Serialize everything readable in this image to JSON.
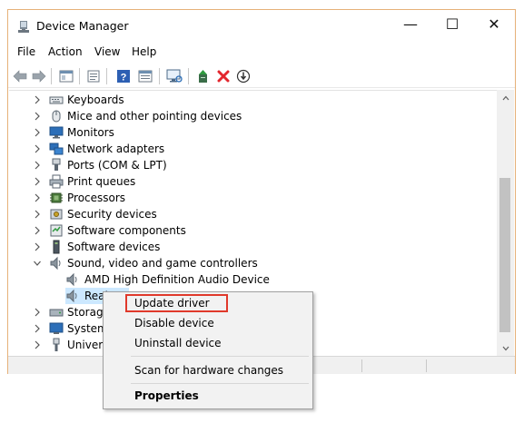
{
  "window": {
    "title": "Device Manager",
    "title_icon": "computer-manage-icon",
    "controls": {
      "minimize": "—",
      "maximize": "☐",
      "close": "✕"
    }
  },
  "menu": [
    "File",
    "Action",
    "View",
    "Help"
  ],
  "toolbar": [
    "back-icon",
    "forward-icon",
    "properties-pane-icon",
    "details-icon",
    "help-icon",
    "device-view-icon",
    "monitor-scan-icon",
    "update-driver-icon",
    "uninstall-icon",
    "disable-icon"
  ],
  "tree": [
    {
      "label": "Keyboards",
      "expanded": false,
      "icon": "keyboard-icon"
    },
    {
      "label": "Mice and other pointing devices",
      "expanded": false,
      "icon": "mouse-icon"
    },
    {
      "label": "Monitors",
      "expanded": false,
      "icon": "monitor-icon"
    },
    {
      "label": "Network adapters",
      "expanded": false,
      "icon": "network-icon"
    },
    {
      "label": "Ports (COM & LPT)",
      "expanded": false,
      "icon": "port-icon"
    },
    {
      "label": "Print queues",
      "expanded": false,
      "icon": "printer-icon"
    },
    {
      "label": "Processors",
      "expanded": false,
      "icon": "processor-icon"
    },
    {
      "label": "Security devices",
      "expanded": false,
      "icon": "security-icon"
    },
    {
      "label": "Software components",
      "expanded": false,
      "icon": "component-icon"
    },
    {
      "label": "Software devices",
      "expanded": false,
      "icon": "software-device-icon"
    },
    {
      "label": "Sound, video and game controllers",
      "expanded": true,
      "icon": "speaker-icon"
    },
    {
      "label": "AMD High Definition Audio Device",
      "child": true,
      "icon": "speaker-icon"
    },
    {
      "label": "Real",
      "child": true,
      "selected": true,
      "icon": "speaker-icon"
    },
    {
      "label": "Storage",
      "expanded": false,
      "icon": "storage-icon"
    },
    {
      "label": "System",
      "expanded": false,
      "icon": "system-icon"
    },
    {
      "label": "Univers",
      "expanded": false,
      "icon": "usb-icon"
    }
  ],
  "context_menu": {
    "update": "Update driver",
    "disable": "Disable device",
    "uninstall": "Uninstall device",
    "scan": "Scan for hardware changes",
    "properties": "Properties"
  },
  "colors": {
    "window_border": "#e6b179",
    "selection": "#cce8ff",
    "highlight_box": "#e0392b",
    "uninstall_red": "#e3262d",
    "folder_blue": "#2d6fb8"
  }
}
